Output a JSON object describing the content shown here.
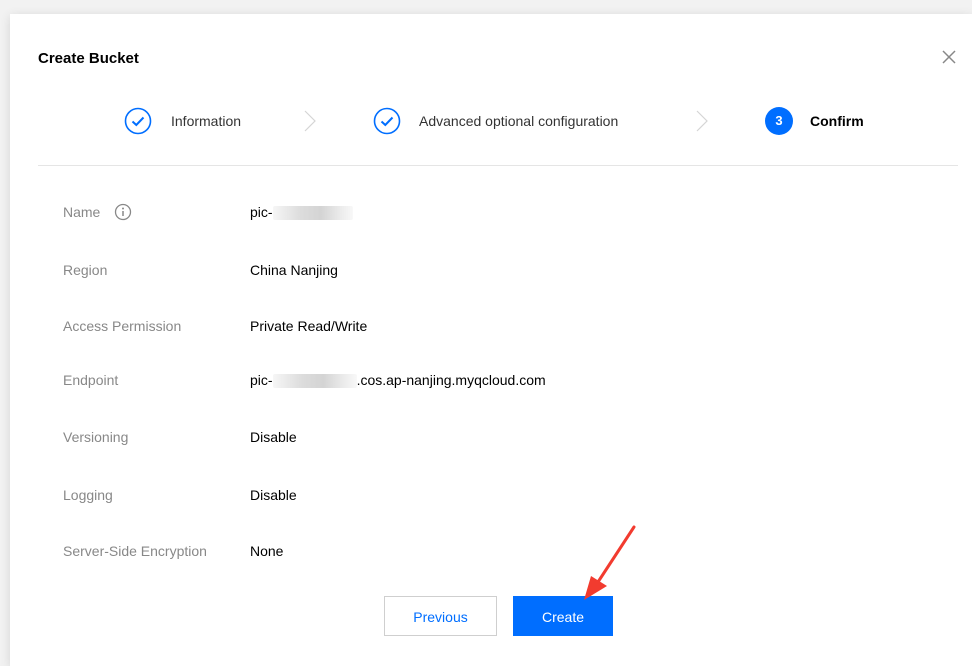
{
  "dialog": {
    "title": "Create Bucket",
    "close_icon": "close-icon"
  },
  "steps": [
    {
      "label": "Information",
      "state": "done",
      "icon": "check-circle-icon"
    },
    {
      "label": "Advanced optional configuration",
      "state": "done",
      "icon": "check-circle-icon"
    },
    {
      "number": "3",
      "label": "Confirm",
      "state": "active"
    }
  ],
  "fields": {
    "name": {
      "label": "Name",
      "value": "pic-",
      "icon": "info-icon"
    },
    "region": {
      "label": "Region",
      "value": "China Nanjing"
    },
    "access": {
      "label": "Access Permission",
      "value": "Private Read/Write"
    },
    "endpoint": {
      "label": "Endpoint",
      "value_prefix": "pic-",
      "value_suffix": ".cos.ap-nanjing.myqcloud.com"
    },
    "versioning": {
      "label": "Versioning",
      "value": "Disable"
    },
    "logging": {
      "label": "Logging",
      "value": "Disable"
    },
    "encryption": {
      "label": "Server-Side Encryption",
      "value": "None"
    }
  },
  "buttons": {
    "previous": "Previous",
    "create": "Create"
  },
  "colors": {
    "primary": "#006eff",
    "annotation_arrow": "#f23b2f",
    "label_gray": "#888888"
  }
}
